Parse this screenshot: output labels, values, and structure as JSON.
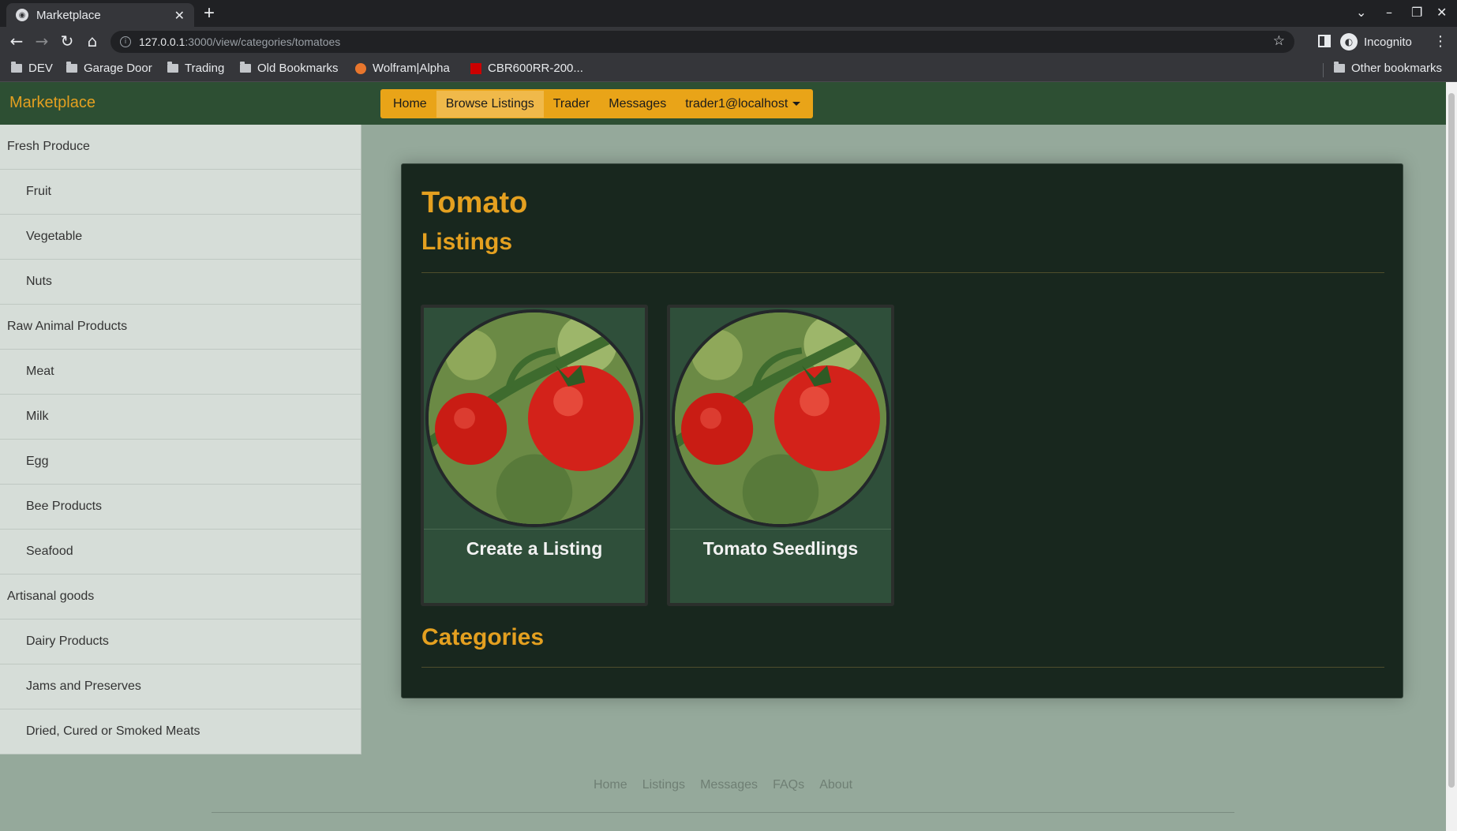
{
  "browser": {
    "tab_title": "Marketplace",
    "url_host": "127.0.0.1",
    "url_path": ":3000/view/categories/tomatoes",
    "profile_label": "Incognito",
    "bookmarks": [
      "DEV",
      "Garage Door",
      "Trading",
      "Old Bookmarks",
      "Wolfram|Alpha",
      "CBR600RR-200...",
      "Other bookmarks"
    ]
  },
  "app": {
    "brand": "Marketplace",
    "nav": {
      "home": "Home",
      "browse": "Browse Listings",
      "trader": "Trader",
      "messages": "Messages",
      "user": "trader1@localhost"
    }
  },
  "sidebar": {
    "items": [
      {
        "label": "Fresh Produce",
        "level": "top"
      },
      {
        "label": "Fruit",
        "level": "sub"
      },
      {
        "label": "Vegetable",
        "level": "sub"
      },
      {
        "label": "Nuts",
        "level": "sub"
      },
      {
        "label": "Raw Animal Products",
        "level": "top"
      },
      {
        "label": "Meat",
        "level": "sub"
      },
      {
        "label": "Milk",
        "level": "sub"
      },
      {
        "label": "Egg",
        "level": "sub"
      },
      {
        "label": "Bee Products",
        "level": "sub"
      },
      {
        "label": "Seafood",
        "level": "sub"
      },
      {
        "label": "Artisanal goods",
        "level": "top"
      },
      {
        "label": "Dairy Products",
        "level": "sub"
      },
      {
        "label": "Jams and Preserves",
        "level": "sub"
      },
      {
        "label": "Dried, Cured or Smoked Meats",
        "level": "sub"
      }
    ]
  },
  "main": {
    "title": "Tomato",
    "listings_heading": "Listings",
    "categories_heading": "Categories",
    "cards": [
      {
        "title": "Create a Listing"
      },
      {
        "title": "Tomato Seedlings"
      }
    ]
  },
  "footer": {
    "links": [
      "Home",
      "Listings",
      "Messages",
      "FAQs",
      "About"
    ]
  },
  "colors": {
    "accent": "#e4a020",
    "nav_bg": "#2d4f33",
    "panel_bg": "#18271e",
    "page_bg": "#95a99b"
  }
}
